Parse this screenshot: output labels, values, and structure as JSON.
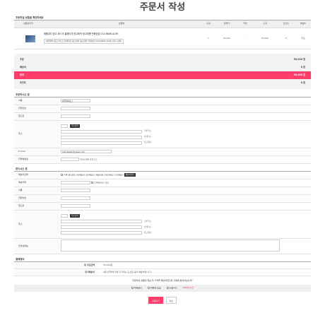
{
  "page": {
    "title": "주문서 작성"
  },
  "products": {
    "section_title": "주문하실 상품을 확인하세요",
    "columns": [
      "상품이미지",
      "상품명",
      "수량",
      "판매가",
      "적립",
      "소계",
      "포인트",
      "배송비"
    ],
    "rows": [
      {
        "name": "애플워치 광고 마스크 홈페이지 광고제작 광고대행 전화상담 010-6808-4109",
        "option": "애플워치 광고 마스크 홈페이지 광고제작 광고대행 전화상담 010-6808-4109 1개 (+0원)",
        "qty": "1",
        "price": "50,000",
        "point": "-",
        "subtotal": "50,000",
        "reward": "0",
        "shipping": "무료"
      }
    ]
  },
  "summary": {
    "rows": [
      {
        "label": "주문",
        "value": "50,000 원"
      },
      {
        "label": "배송비",
        "value": "0 원"
      },
      {
        "label": "총계",
        "value": "50,000 원"
      },
      {
        "label": "포인트",
        "value": "0 점"
      }
    ]
  },
  "orderer": {
    "section_title": "주문하시는 분",
    "name_label": "이름",
    "name_value": "애플워치광고",
    "phone_label": "전화번호",
    "mobile_label": "핸드폰",
    "address_label": "주소",
    "zip_button": "주소검색",
    "addr1_note": "기본주소",
    "addr2_note": "상세주소",
    "addr3_note": "참고항목",
    "email_label": "E-mail",
    "email_value": "mandbeam@naver.com",
    "birth_label": "희망배송일",
    "birth_note": "이후로 배송 바랍니다"
  },
  "receiver": {
    "section_title": "받으시는 분",
    "choice_label": "배송지선택",
    "choice_options": "주문자와 동일  신규배송지  최근배송지 (배송지를 선택하세요)  신규배송지",
    "choice_button": "배송지목록",
    "addr_name_label": "배송지명",
    "addr_default": "기본배송지로 설정",
    "name_label": "이름",
    "phone_label": "전화번호",
    "mobile_label": "핸드폰",
    "address_label": "주소",
    "zip_button": "주소검색",
    "addr1_note": "기본주소",
    "addr2_note": "상세주소",
    "addr3_note": "참고항목",
    "memo_label": "전하실말씀"
  },
  "payment": {
    "section_title": "결제정보",
    "amount_label": "총 주문금액",
    "amount_value": "50,000원",
    "point_label": "추가배송비",
    "point_value": "0원 (지역에 따라 추가되는 도선료 등의 배송비입니다.)"
  },
  "agreement": {
    "note": "주문하실 상품의 정보 및 가격을 확인하였으며 구매에 동의하십니까?",
    "options": [
      "주문동의",
      "무통장 입금",
      "신용카드",
      "KG이니시스"
    ]
  },
  "buttons": {
    "submit": "주문하기",
    "cancel": "취소"
  }
}
